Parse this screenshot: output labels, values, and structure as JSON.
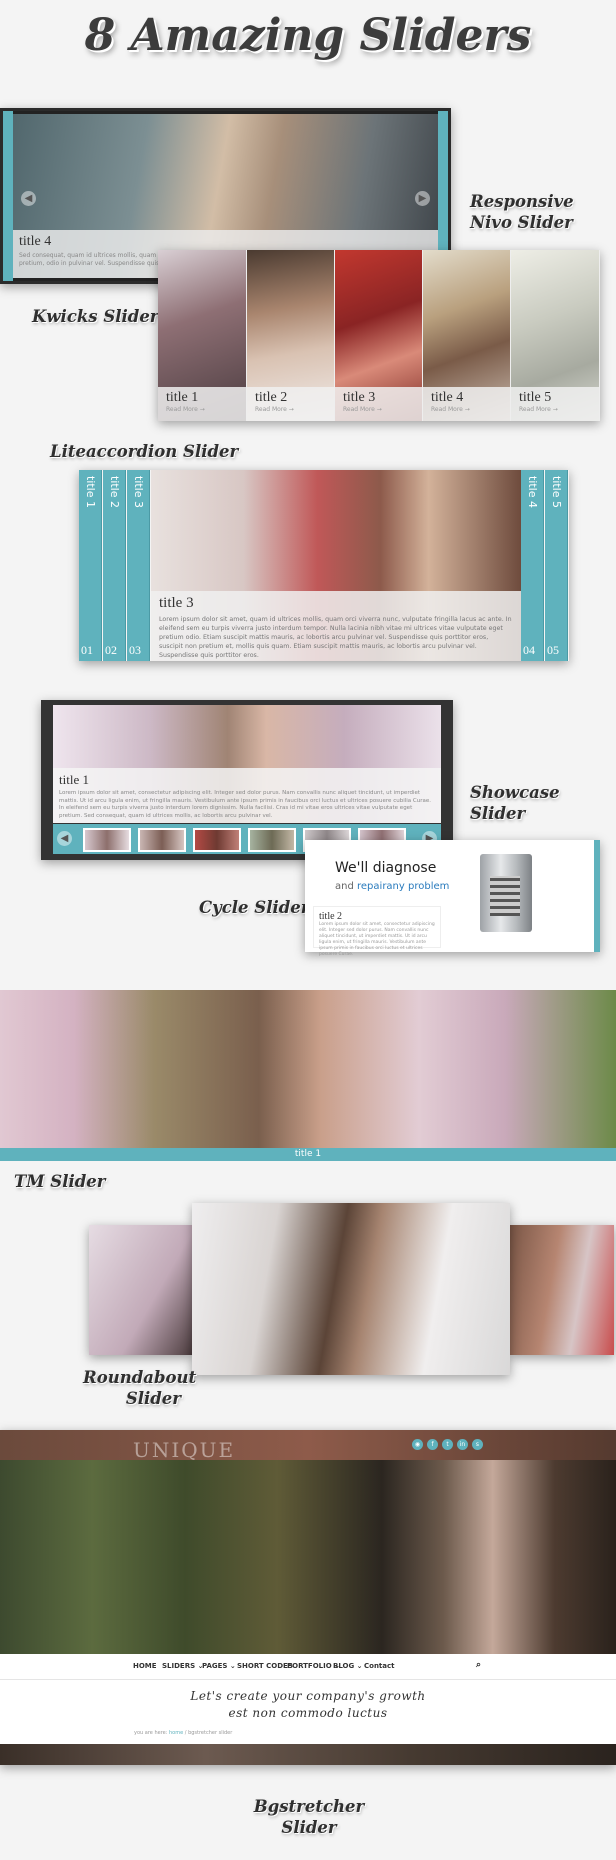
{
  "title": "8 Amazing Sliders",
  "labels": {
    "nivo": [
      "Responsive",
      "Nivo Slider"
    ],
    "kwicks": "Kwicks Slider",
    "lite": "Liteaccordion Slider",
    "showcase": "Showcase Slider",
    "cycle": "Cycle Slider",
    "tm": "TM Slider",
    "roundabout": [
      "Roundabout",
      "Slider"
    ],
    "bgstretcher": [
      "Bgstretcher",
      "Slider"
    ]
  },
  "nivo": {
    "caption_title": "title 4",
    "caption_text": "Sed consequat, quam id ultrices mollis, quam orci viverra nunc, vulputate fringilla lacinia nibh vitae mi ultrices vitae vulputate eget pretium, odio in pulvinar vel. Suspendisse quis porttitor eros",
    "prev_icon": "arrow-left-icon",
    "next_icon": "arrow-right-icon"
  },
  "kwicks": {
    "panels": [
      {
        "title": "title 1",
        "more": "Read More →"
      },
      {
        "title": "title 2",
        "more": "Read More →"
      },
      {
        "title": "title 3",
        "more": "Read More →"
      },
      {
        "title": "title 4",
        "more": "Read More →"
      },
      {
        "title": "title 5",
        "more": "Read More →"
      }
    ]
  },
  "lite": {
    "spines": [
      {
        "title": "title 1",
        "num": "01"
      },
      {
        "title": "title 2",
        "num": "02"
      },
      {
        "title": "title 3",
        "num": "03"
      },
      {
        "title": "title 4",
        "num": "04"
      },
      {
        "title": "title 5",
        "num": "05"
      }
    ],
    "active_title": "title 3",
    "active_text": "Lorem ipsum dolor sit amet, quam id ultrices mollis, quam orci viverra nunc, vulputate fringilla lacus ac ante. In eleifend sem eu turpis viverra justo interdum tempor. Nulla lacinia nibh vitae mi ultrices vitae vulputate eget pretium odio. Etiam suscipit mattis mauris, ac lobortis arcu pulvinar vel. Suspendisse quis porttitor eros, suscipit non pretium et, mollis quis quam. Etiam suscipit mattis mauris, ac lobortis arcu pulvinar vel. Suspendisse quis porttitor eros."
  },
  "showcase": {
    "caption_title": "title 1",
    "caption_text": "Lorem ipsum dolor sit amet, consectetur adipiscing elit. Integer sed dolor purus. Nam convallis nunc aliquet tincidunt, ut imperdiet mattis. Ut id arcu ligula enim, ut fringilla mauris. Vestibulum ante ipsum primis in faucibus orci luctus et ultrices posuere cubilia Curae. In eleifend sem eu turpis viverra justo interdum lorem dignissim. Nulla facilisi. Cras id mi vitae eros ultrices vitae vulputate eget pretium. Sed consequat, quam id ultrices mollis, ac lobortis arcu pulvinar vel.",
    "prev_icon": "arrow-left-icon",
    "next_icon": "arrow-right-icon"
  },
  "cycle": {
    "heading": "We'll diagnose",
    "sub_prefix": "and",
    "sub_highlight": "repairany problem",
    "caption_title": "title 2",
    "caption_text": "Lorem ipsum dolor sit amet, consectetur adipiscing elit. Integer sed dolor purus. Nam convallis nunc aliquet tincidunt, ut imperdiet mattis. Ut id arcu ligula enim, ut fringilla mauris. Vestibulum ante ipsum primis in faucibus orci luctus et ultrices posuere Curae."
  },
  "tm": {
    "caption": "title 1"
  },
  "bgstretcher": {
    "logo": "UNIQUE",
    "nav": [
      "HOME",
      "SLIDERS ⌄",
      "PAGES ⌄",
      "SHORT CODES",
      "PORTFOLIO ⌄",
      "BLOG ⌄",
      "Contact"
    ],
    "tagline": [
      "Let's create your company's growth",
      "est non commodo luctus"
    ],
    "crumb_prefix": "you are here:",
    "crumb_home": "home",
    "crumb_current": "bgstretcher slider",
    "social_icons": [
      "rss-icon",
      "facebook-icon",
      "twitter-icon",
      "linkedin-icon",
      "skype-icon"
    ],
    "search_icon": "search-icon"
  },
  "colors": {
    "accent": "#5fb2bd",
    "background": "#f4f4f4",
    "label_text": "#2f2f2f"
  }
}
